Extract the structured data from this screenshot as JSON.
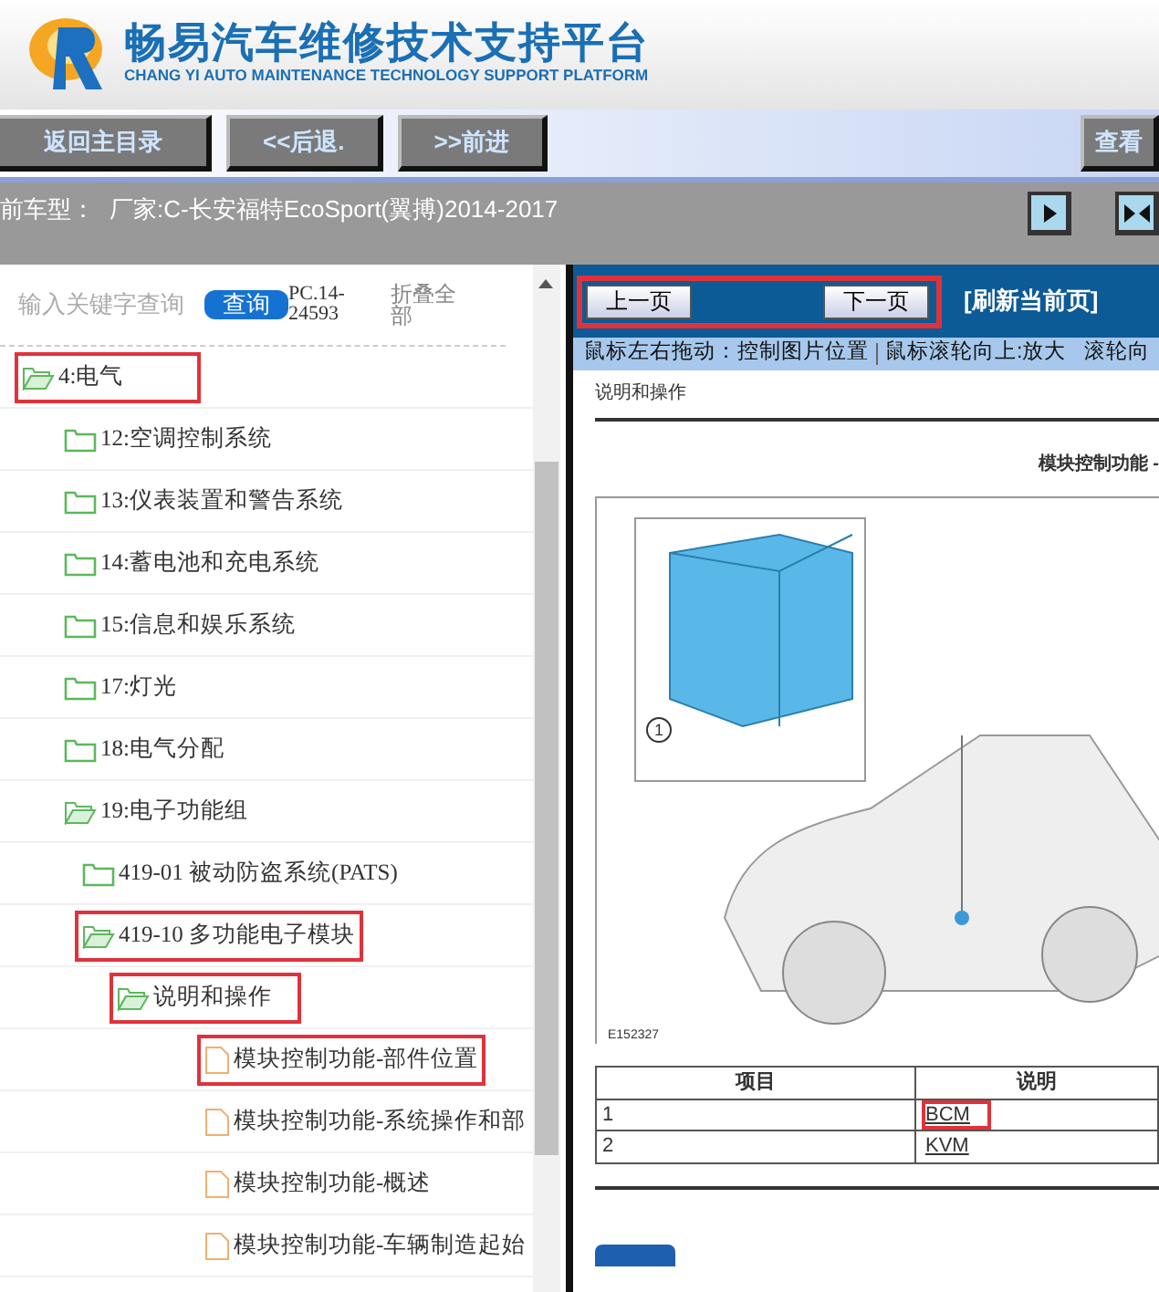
{
  "header": {
    "title": "畅易汽车维修技术支持平台",
    "subtitle": "CHANG YI AUTO MAINTENANCE TECHNOLOGY SUPPORT PLATFORM"
  },
  "toolbar": {
    "buttons": [
      "返回主目录",
      "<<后退.",
      ">>前进"
    ],
    "right_button": "查看"
  },
  "car_model": {
    "label": "前车型：",
    "value": "厂家:C-长安福特EcoSport(翼搏)2014-2017"
  },
  "search": {
    "placeholder": "输入关键字查询",
    "button": "查询",
    "code": "PC.14-24593",
    "collapse": "折叠全部"
  },
  "tree": [
    {
      "kind": "folder",
      "label": "4:电气",
      "expanded": true,
      "annotated": true,
      "children": [
        {
          "kind": "folder",
          "label": "12:空调控制系统",
          "expanded": false,
          "annotated": false
        },
        {
          "kind": "folder",
          "label": "13:仪表装置和警告系统",
          "expanded": false,
          "annotated": false
        },
        {
          "kind": "folder",
          "label": "14:蓄电池和充电系统",
          "expanded": false,
          "annotated": false
        },
        {
          "kind": "folder",
          "label": "15:信息和娱乐系统",
          "expanded": false,
          "annotated": false
        },
        {
          "kind": "folder",
          "label": "17:灯光",
          "expanded": false,
          "annotated": false
        },
        {
          "kind": "folder",
          "label": "18:电气分配",
          "expanded": false,
          "annotated": false
        },
        {
          "kind": "folder",
          "label": "19:电子功能组",
          "expanded": true,
          "annotated": false,
          "children": [
            {
              "kind": "folder",
              "label": "419-01 被动防盗系统(PATS)",
              "expanded": false,
              "annotated": false
            },
            {
              "kind": "folder",
              "label": "419-10 多功能电子模块",
              "expanded": true,
              "annotated": true,
              "children": [
                {
                  "kind": "folder",
                  "label": "说明和操作",
                  "expanded": true,
                  "annotated": true,
                  "children": [
                    {
                      "kind": "file",
                      "label": "模块控制功能-部件位置",
                      "annotated": true
                    },
                    {
                      "kind": "file",
                      "label": "模块控制功能-系统操作和部",
                      "annotated": false
                    },
                    {
                      "kind": "file",
                      "label": "模块控制功能-概述",
                      "annotated": false
                    },
                    {
                      "kind": "file",
                      "label": "模块控制功能-车辆制造起始",
                      "annotated": false
                    }
                  ]
                }
              ]
            }
          ]
        }
      ]
    }
  ],
  "viewer": {
    "prev": "上一页",
    "next": "下一页",
    "refresh": "[刷新当前页]",
    "nav_annotated": true,
    "hints": [
      "鼠标左右拖动：控制图片位置",
      "鼠标滚轮向上:放大",
      "滚轮向"
    ],
    "doc": {
      "section": "说明和操作",
      "heading": "模块控制功能 - ",
      "callout": "1",
      "caption": "E152327",
      "columns": [
        "项目",
        "说明"
      ],
      "rows": [
        {
          "item": "1",
          "desc": "BCM",
          "annotated": true
        },
        {
          "item": "2",
          "desc": "KVM",
          "annotated": false
        }
      ]
    }
  }
}
